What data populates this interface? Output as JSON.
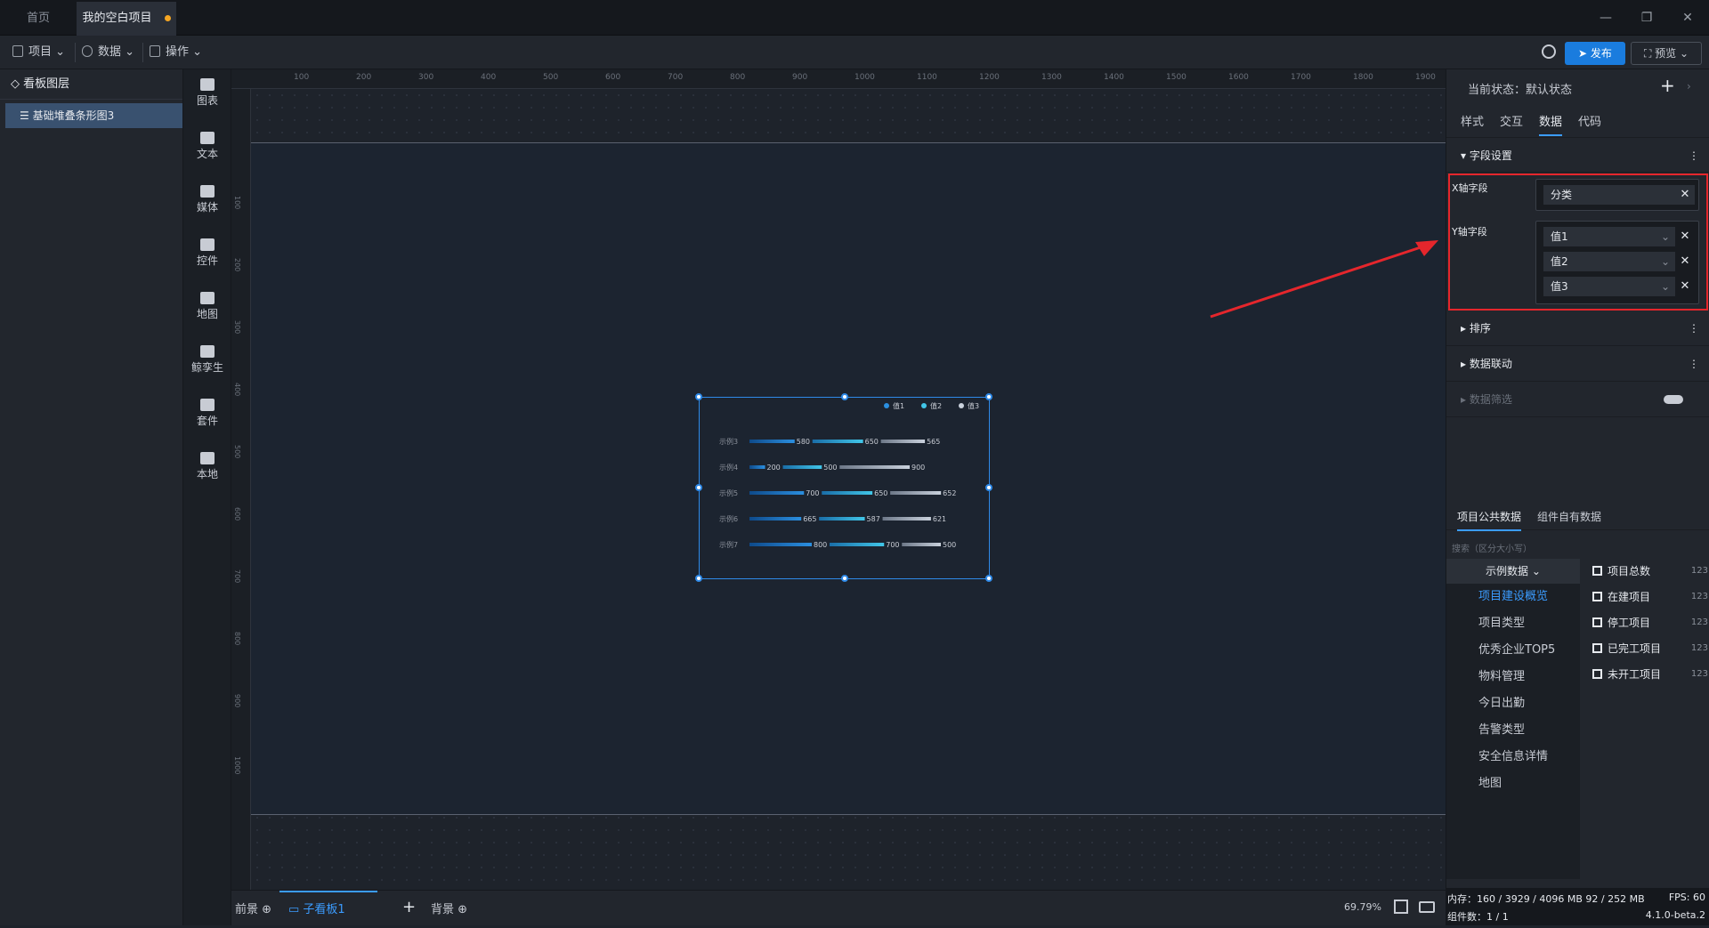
{
  "tabs": {
    "home": "首页",
    "project": "我的空白项目"
  },
  "toolbar": {
    "project": "项目",
    "data": "数据",
    "operate": "操作",
    "publish": "发布",
    "preview": "预览"
  },
  "layers": {
    "title": "看板图层",
    "item": "基础堆叠条形图3"
  },
  "components": [
    "图表",
    "文本",
    "媒体",
    "控件",
    "地图",
    "鲸孪生",
    "套件",
    "本地"
  ],
  "ruler": {
    "top": [
      "100",
      "200",
      "300",
      "400",
      "500",
      "600",
      "700",
      "800",
      "900",
      "1000",
      "1100",
      "1200",
      "1300",
      "1400",
      "1500",
      "1600",
      "1700",
      "1800",
      "1900"
    ],
    "left": [
      "100",
      "200",
      "300",
      "400",
      "500",
      "600",
      "700",
      "800",
      "900",
      "1000"
    ]
  },
  "chart_data": {
    "type": "bar",
    "stacked": true,
    "orientation": "horizontal",
    "categories": [
      "示例3",
      "示例4",
      "示例5",
      "示例6",
      "示例7"
    ],
    "series": [
      {
        "name": "值1",
        "values": [
          580,
          200,
          700,
          665,
          800
        ]
      },
      {
        "name": "值2",
        "values": [
          650,
          500,
          650,
          587,
          700
        ]
      },
      {
        "name": "值3",
        "values": [
          565,
          900,
          652,
          621,
          500
        ]
      }
    ],
    "legend": "top-right"
  },
  "bottom": {
    "front": "前景",
    "board": "子看板1",
    "back": "背景",
    "zoom": "69.79%"
  },
  "right": {
    "state_label": "当前状态：",
    "state_value": "默认状态",
    "tabs": [
      "样式",
      "交互",
      "数据",
      "代码"
    ],
    "field_settings": "字段设置",
    "x_label": "X轴字段",
    "x_value": "分类",
    "y_label": "Y轴字段",
    "y_values": [
      "值1",
      "值2",
      "值3"
    ],
    "sort": "排序",
    "linkage": "数据联动",
    "filter": "数据筛选"
  },
  "datasrc": {
    "tabs": [
      "项目公共数据",
      "组件自有数据"
    ],
    "search_placeholder": "搜索（区分大小写）",
    "group": "示例数据",
    "list": [
      "项目建设概览",
      "项目类型",
      "优秀企业TOP5",
      "物料管理",
      "今日出勤",
      "告警类型",
      "安全信息详情",
      "地图"
    ],
    "fields": [
      "项目总数",
      "在建项目",
      "停工项目",
      "已完工项目",
      "未开工项目"
    ],
    "type": "123"
  },
  "status": {
    "mem_label": "内存：",
    "mem": "160 / 3929 / 4096 MB",
    "mem2": "92 / 252 MB",
    "fps_label": "FPS:",
    "fps": "60",
    "comp_label": "组件数：",
    "comp": "1 / 1",
    "version": "4.1.0-beta.2"
  },
  "colors": {
    "accent": "#1a7cde",
    "highlight": "#e5262c"
  }
}
